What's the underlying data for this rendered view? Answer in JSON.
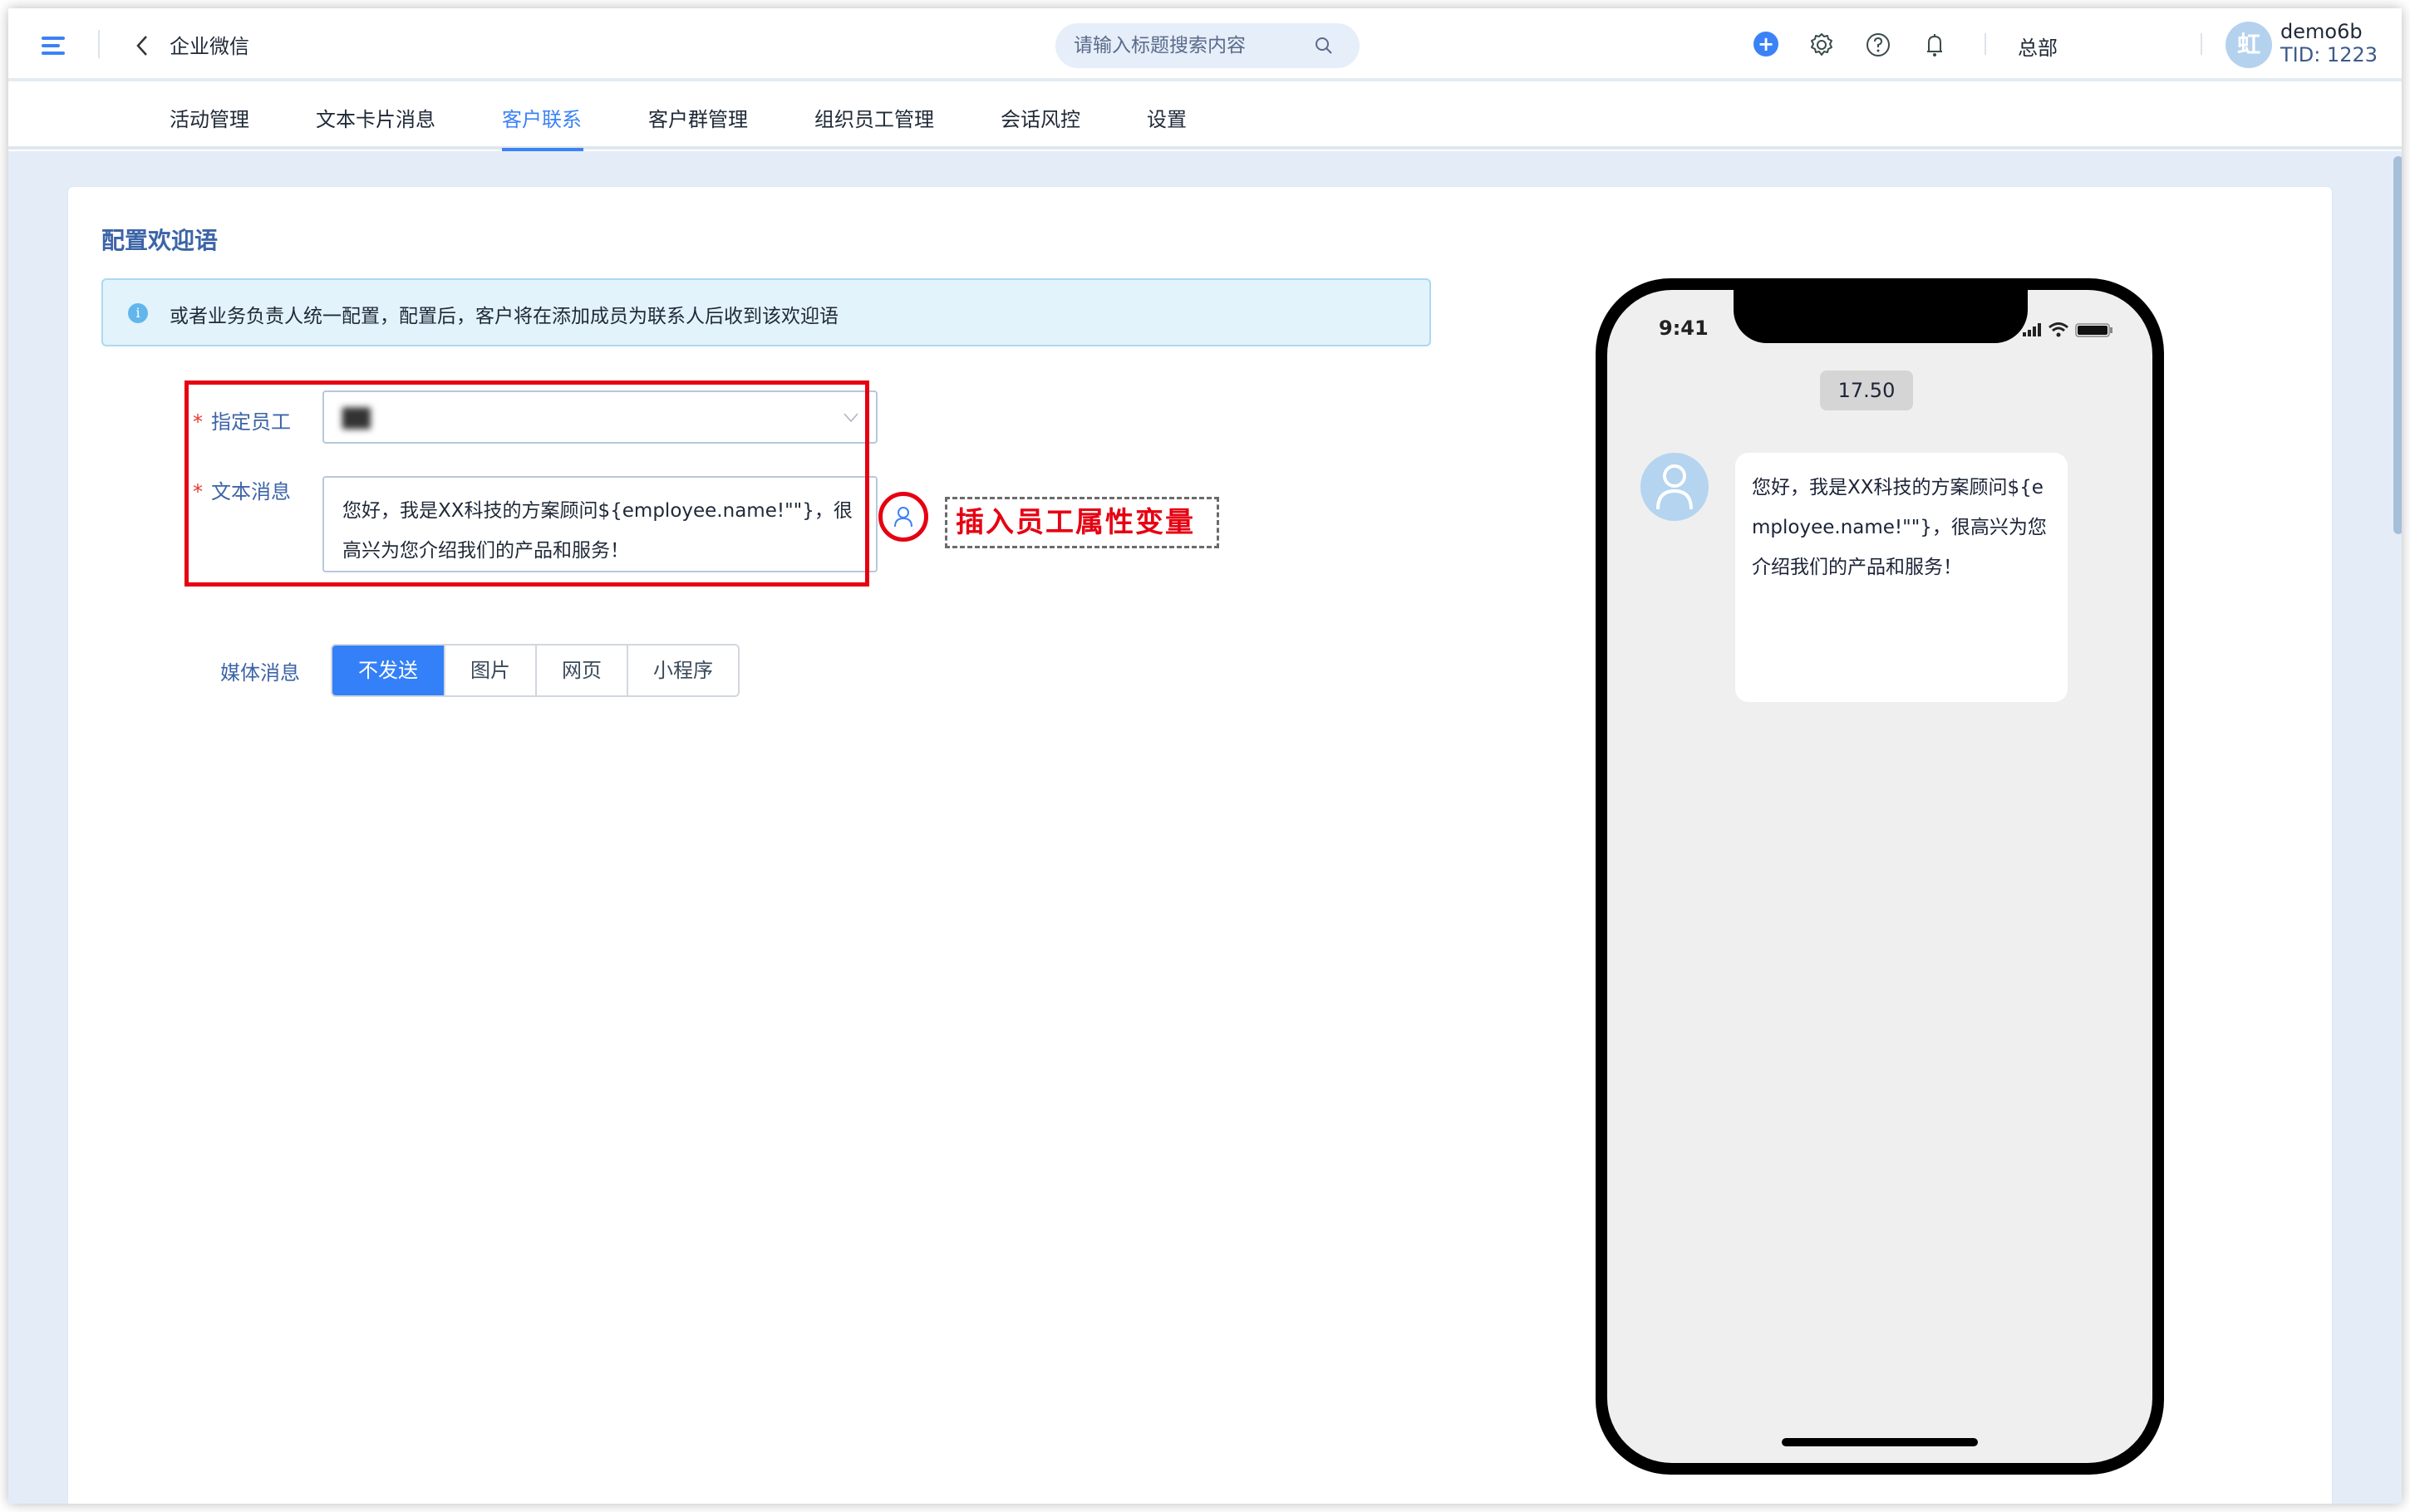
{
  "header": {
    "app_title": "企业微信",
    "search_placeholder": "请输入标题搜索内容",
    "org_label": "总部",
    "user": {
      "avatar_text": "虹",
      "name": "demo6b",
      "tid": "TID: 1223"
    },
    "icons": [
      "menu-icon",
      "back-icon",
      "search-icon",
      "plus-icon",
      "gear-icon",
      "help-icon",
      "bell-icon"
    ]
  },
  "nav": {
    "tabs": [
      {
        "label": "活动管理",
        "active": false
      },
      {
        "label": "文本卡片消息",
        "active": false
      },
      {
        "label": "客户联系",
        "active": true
      },
      {
        "label": "客户群管理",
        "active": false
      },
      {
        "label": "组织员工管理",
        "active": false
      },
      {
        "label": "会话风控",
        "active": false
      },
      {
        "label": "设置",
        "active": false
      }
    ]
  },
  "page": {
    "title": "配置欢迎语",
    "info": "或者业务负责人统一配置，配置后，客户将在添加成员为联系人后收到该欢迎语",
    "form": {
      "employee_label": "指定员工",
      "employee_value": "██",
      "message_label": "文本消息",
      "message_value": "您好，我是XX科技的方案顾问${employee.name!\"\"}，很高兴为您介绍我们的产品和服务！",
      "required_mark": "*",
      "media_label": "媒体消息",
      "media_options": [
        {
          "label": "不发送",
          "active": true
        },
        {
          "label": "图片",
          "active": false
        },
        {
          "label": "网页",
          "active": false
        },
        {
          "label": "小程序",
          "active": false
        }
      ]
    },
    "annotation": "插入员工属性变量"
  },
  "preview": {
    "status_time": "9:41",
    "chat_time": "17.50",
    "message": "您好，我是XX科技的方案顾问${employee.name!\"\"}，很高兴为您介绍我们的产品和服务！"
  },
  "colors": {
    "accent": "#3b82f6",
    "annotation_red": "#e60012",
    "label_blue": "#3d64a8",
    "content_bg": "#e4ecf8",
    "info_bg": "#e3f3fb"
  }
}
